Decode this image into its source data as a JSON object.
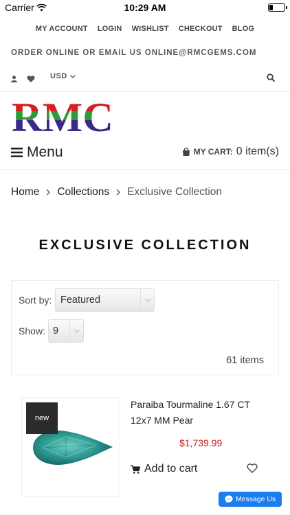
{
  "status_bar": {
    "carrier": "Carrier",
    "time": "10:29 AM",
    "battery_level": 0.25
  },
  "top_links": [
    "MY ACCOUNT",
    "LOGIN",
    "WISHLIST",
    "CHECKOUT",
    "BLOG"
  ],
  "promo_text": "ORDER ONLINE OR EMAIL US ONLINE@RMCGEMS.COM",
  "utility": {
    "currency": "USD",
    "icons": [
      "user-icon",
      "heart-icon",
      "chevron-down-icon",
      "search-icon"
    ]
  },
  "logo": {
    "text": "RMC",
    "colors": [
      "#d42020",
      "#2e9a3a",
      "#3a2a88"
    ]
  },
  "nav": {
    "menu_label": "Menu",
    "cart_label": "MY CART:",
    "cart_count": "0 item(s)"
  },
  "breadcrumb": {
    "home": "Home",
    "collections": "Collections",
    "current": "Exclusive Collection"
  },
  "page_title": "EXCLUSIVE COLLECTION",
  "toolbar": {
    "sort_label": "Sort by:",
    "sort_value": "Featured",
    "show_label": "Show:",
    "show_value": "9",
    "item_count": "61 items"
  },
  "products": [
    {
      "badge": "new",
      "name": "Paraiba Tourmaline 1.67 CT 12x7 MM Pear",
      "price": "$1,739.99",
      "add_to_cart": "Add to cart"
    }
  ],
  "messenger": {
    "label": "Message Us"
  },
  "colors": {
    "price": "#cc1a1a",
    "messenger": "#1a7df0",
    "badge": "#2b2b2b"
  }
}
